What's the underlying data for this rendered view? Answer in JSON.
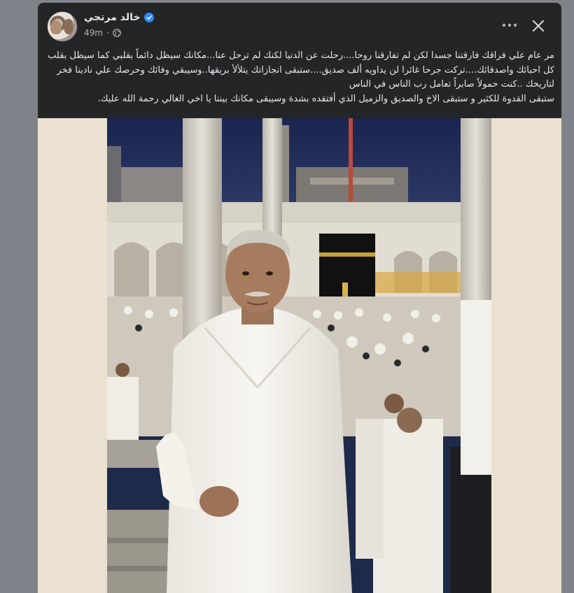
{
  "post": {
    "author_name": "خالد مرتجي",
    "timestamp": "49m",
    "privacy_icon": "globe-icon",
    "verified_icon": "verified-badge-icon",
    "more_icon": "more-options-icon",
    "close_icon": "close-icon",
    "body_lines": [
      "مر عام علي فراقك  فارقتنا جسدا  لكن لم تفارقنا روحا....رحلت عن الدنيا لكنك لم ترحل عنا...مكانك سيظل دائماً بقلبي كما سيظل بقلب",
      "كل احبائك واصدقائك....تركت جرحا غائرا لن يداويه ألف صديق....ستبقى انجازاتك يتلألأ بريقها..وسيبقي وفائك وحرصك علي نادينا فخر",
      "لتاريخك  ..كنت حمولاً صابراً تعامل رب الناس في الناس",
      "ستبقى القدوة للكثير و ستبقى الاخ والصديق والزميل الذي أفتقده بشدة وسيبقى مكانك بيننا يا اخي الغالي رحمة الله عليك."
    ]
  },
  "colors": {
    "page_bg": "#7f8289",
    "card_bg": "#242526",
    "text_primary": "#e4e6eb",
    "text_secondary": "#b0b3b8",
    "verified_blue": "#2d88ff",
    "photo_border": "#ebe1d0"
  }
}
